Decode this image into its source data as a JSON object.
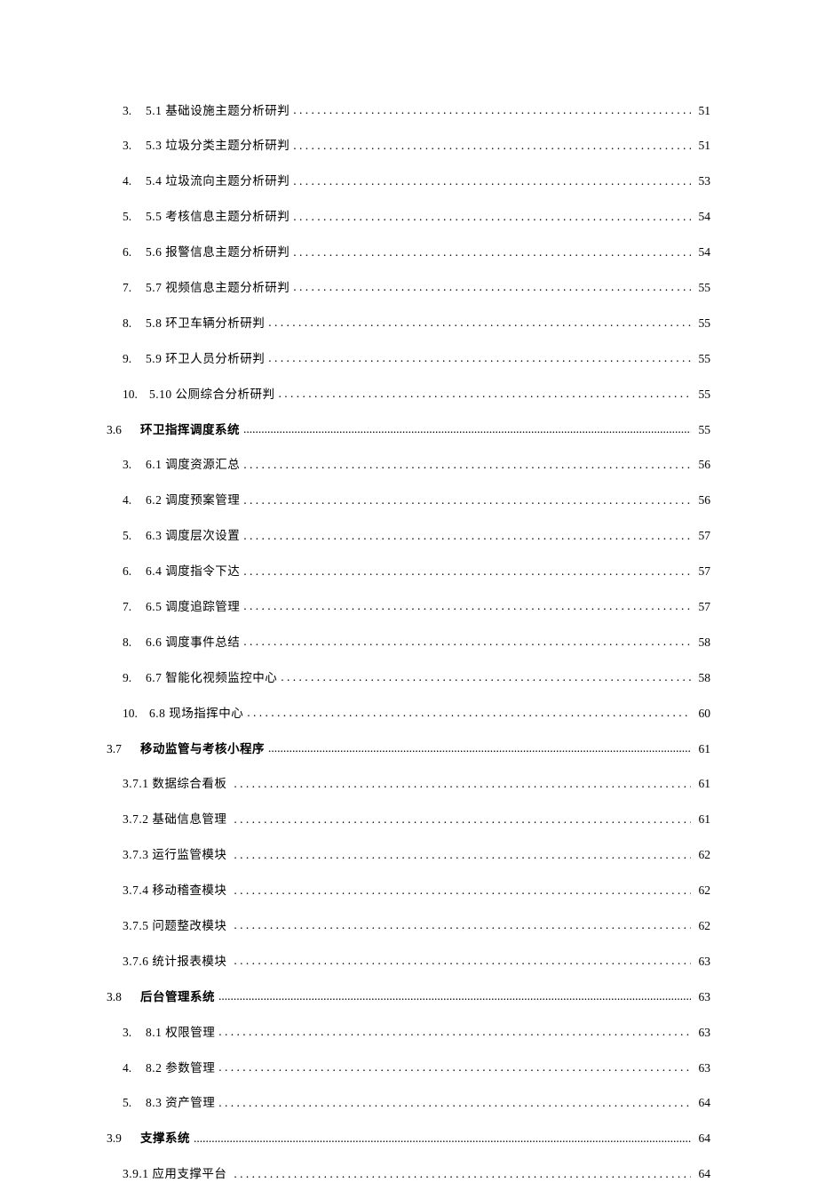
{
  "toc": [
    {
      "kind": "item",
      "num": "3.",
      "label": "5.1 基础设施主题分析研判",
      "page": "51",
      "leader": "spaced",
      "numClass": "indent-1"
    },
    {
      "kind": "item",
      "num": "3.",
      "label": "5.3 垃圾分类主题分析研判",
      "page": "51",
      "leader": "spaced",
      "numClass": "indent-1"
    },
    {
      "kind": "item",
      "num": "4.",
      "label": "5.4 垃圾流向主题分析研判",
      "page": "53",
      "leader": "spaced",
      "numClass": "indent-1"
    },
    {
      "kind": "item",
      "num": "5.",
      "label": "5.5 考核信息主题分析研判",
      "page": "54",
      "leader": "spaced",
      "numClass": "indent-1"
    },
    {
      "kind": "item",
      "num": "6.",
      "label": "5.6 报警信息主题分析研判",
      "page": "54",
      "leader": "spaced",
      "numClass": "indent-1"
    },
    {
      "kind": "item",
      "num": "7.",
      "label": "5.7 视频信息主题分析研判",
      "page": "55",
      "leader": "spaced",
      "numClass": "indent-1"
    },
    {
      "kind": "item",
      "num": "8.",
      "label": "5.8 环卫车辆分析研判",
      "page": "55",
      "leader": "spaced",
      "numClass": "indent-1"
    },
    {
      "kind": "item",
      "num": "9.",
      "label": "5.9 环卫人员分析研判",
      "page": "55",
      "leader": "spaced",
      "numClass": "indent-1"
    },
    {
      "kind": "item",
      "num": "10.",
      "label": "5.10 公厕综合分析研判",
      "page": "55",
      "leader": "spaced",
      "numClass": "indent-1b"
    },
    {
      "kind": "section",
      "num": "3.6",
      "label": "环卫指挥调度系统",
      "page": "55",
      "leader": "dense"
    },
    {
      "kind": "item",
      "num": "3.",
      "label": "6.1 调度资源汇总",
      "page": "56",
      "leader": "spaced",
      "numClass": "indent-1"
    },
    {
      "kind": "item",
      "num": "4.",
      "label": "6.2 调度预案管理",
      "page": "56",
      "leader": "spaced",
      "numClass": "indent-1"
    },
    {
      "kind": "item",
      "num": "5.",
      "label": "6.3 调度层次设置",
      "page": "57",
      "leader": "spaced",
      "numClass": "indent-1"
    },
    {
      "kind": "item",
      "num": "6.",
      "label": "6.4 调度指令下达",
      "page": "57",
      "leader": "spaced",
      "numClass": "indent-1"
    },
    {
      "kind": "item",
      "num": "7.",
      "label": "6.5 调度追踪管理",
      "page": "57",
      "leader": "spaced",
      "numClass": "indent-1"
    },
    {
      "kind": "item",
      "num": "8.",
      "label": "6.6 调度事件总结",
      "page": "58",
      "leader": "spaced",
      "numClass": "indent-1"
    },
    {
      "kind": "item",
      "num": "9.",
      "label": "6.7 智能化视频监控中心",
      "page": "58",
      "leader": "spaced",
      "numClass": "indent-1"
    },
    {
      "kind": "item",
      "num": "10.",
      "label": "6.8 现场指挥中心",
      "page": "60",
      "leader": "spaced",
      "numClass": "indent-1b"
    },
    {
      "kind": "section",
      "num": "3.7",
      "label": "移动监管与考核小程序",
      "page": "61",
      "leader": "dense"
    },
    {
      "kind": "sub",
      "label": "3.7.1 数据综合看板",
      "page": "61",
      "leader": "spaced"
    },
    {
      "kind": "sub",
      "label": "3.7.2 基础信息管理",
      "page": "61",
      "leader": "spaced"
    },
    {
      "kind": "sub",
      "label": "3.7.3 运行监管模块",
      "page": "62",
      "leader": "spaced"
    },
    {
      "kind": "sub",
      "label": "3.7.4 移动稽查模块",
      "page": "62",
      "leader": "spaced"
    },
    {
      "kind": "sub",
      "label": "3.7.5 问题整改模块",
      "page": "62",
      "leader": "spaced"
    },
    {
      "kind": "sub",
      "label": "3.7.6 统计报表模块",
      "page": "63",
      "leader": "spaced"
    },
    {
      "kind": "section",
      "num": "3.8",
      "label": "后台管理系统",
      "page": "63",
      "leader": "dense"
    },
    {
      "kind": "item",
      "num": "3.",
      "label": "8.1 权限管理",
      "page": "63",
      "leader": "spaced",
      "numClass": "indent-1"
    },
    {
      "kind": "item",
      "num": "4.",
      "label": "8.2 参数管理",
      "page": "63",
      "leader": "spaced",
      "numClass": "indent-1"
    },
    {
      "kind": "item",
      "num": "5.",
      "label": "8.3 资产管理",
      "page": "64",
      "leader": "spaced",
      "numClass": "indent-1"
    },
    {
      "kind": "section",
      "num": "3.9",
      "label": "支撑系统",
      "page": "64",
      "leader": "dense"
    },
    {
      "kind": "sub",
      "label": "3.9.1 应用支撑平台",
      "page": "64",
      "leader": "spaced"
    }
  ]
}
